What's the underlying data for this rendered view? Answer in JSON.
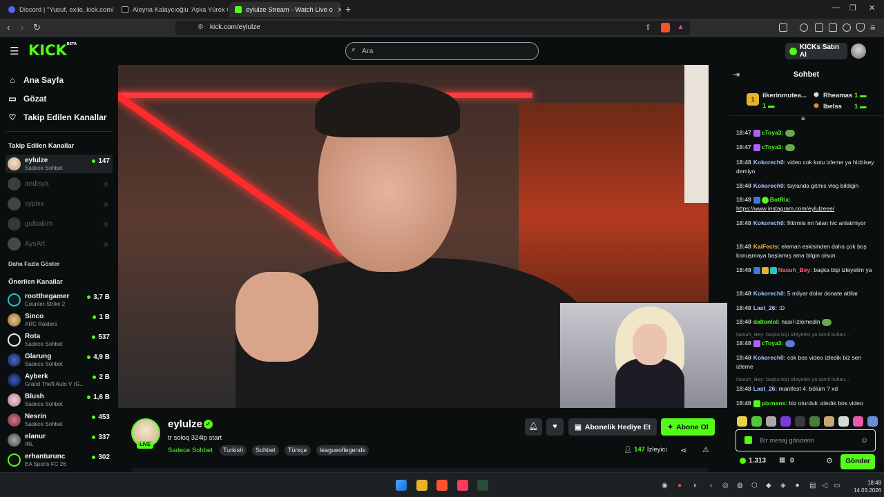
{
  "browser": {
    "tabs": [
      {
        "label": "Discord | \"Yusuf, exile, kick.com/",
        "color": "#5865f2"
      },
      {
        "label": "Aleyna Kalaycıoğlu 'Aşka Yürek Gerek",
        "color": "#111111"
      },
      {
        "label": "eylulze Stream - Watch Live o",
        "color": "#53fc18",
        "active": true
      }
    ],
    "new_tab": "+",
    "url": "kick.com/eylulze"
  },
  "header": {
    "logo": "KICK",
    "logo_sup": "BETA",
    "search_placeholder": "Ara",
    "buy_kicks": "KICKs Satın Al"
  },
  "sidebar": {
    "nav": [
      {
        "label": "Ana Sayfa",
        "icon": "home-icon"
      },
      {
        "label": "Gözat",
        "icon": "browse-icon"
      },
      {
        "label": "Takip Edilen Kanallar",
        "icon": "heart-icon"
      }
    ],
    "followed_title": "Takip Edilen Kanallar",
    "followed": [
      {
        "name": "eylulze",
        "sub": "Sadece Sohbet",
        "viewers": "147",
        "online": true
      },
      {
        "name": "andisya",
        "online": false
      },
      {
        "name": "sypixx",
        "online": false
      },
      {
        "name": "gulbakim",
        "online": false
      },
      {
        "name": "AysArt",
        "online": false
      }
    ],
    "show_more": "Daha Fazla Göster",
    "recommended_title": "Önerilen Kanallar",
    "recommended": [
      {
        "name": "rootthegamer",
        "sub": "Counter-Strike 2",
        "viewers": "3,7 B"
      },
      {
        "name": "Sinco",
        "sub": "ARC Raiders",
        "viewers": "1 B"
      },
      {
        "name": "Rota",
        "sub": "Sadece Sohbet",
        "viewers": "537"
      },
      {
        "name": "Glarung",
        "sub": "Sadece Sohbet",
        "viewers": "4,9 B"
      },
      {
        "name": "Ayberk",
        "sub": "Grand Theft Auto V (G...",
        "viewers": "2 B"
      },
      {
        "name": "Blush",
        "sub": "Sadece Sohbet",
        "viewers": "1,6 B"
      },
      {
        "name": "Nesrin",
        "sub": "Sadece Sohbet",
        "viewers": "453"
      },
      {
        "name": "elanur",
        "sub": "IRL",
        "viewers": "337"
      },
      {
        "name": "erhanturunc",
        "sub": "EA Sports FC 26",
        "viewers": "302"
      }
    ]
  },
  "stream": {
    "channel": "eylulze",
    "live": "LIVE",
    "title": "tr soloq 324lp start",
    "category": "Sadece Sohbet",
    "tags": [
      "Turkish",
      "Sohbet",
      "Türkçe",
      "leagueoflegends"
    ],
    "gift_sub": "Abonelik Hediye Et",
    "subscribe": "Abone Ol",
    "viewers": "147",
    "viewers_label": "İzleyici"
  },
  "chat": {
    "title": "Sohbet",
    "leaders": [
      {
        "rank": "1",
        "name": "ilkerinmutea...",
        "count": "1"
      },
      {
        "name": "Rheamas",
        "count": "1"
      },
      {
        "name": "lbelss",
        "count": "1"
      }
    ],
    "messages": [
      {
        "time": "18:47",
        "user": "cToya3:",
        "color": "#53fc18",
        "text": ""
      },
      {
        "time": "18:47",
        "user": "cToya3:",
        "color": "#53fc18",
        "text": ""
      },
      {
        "time": "18:48",
        "user": "Kokorech0:",
        "color": "#a5c8ff",
        "text": "video cok kotu izleme ya hicbisey demiyo"
      },
      {
        "time": "18:48",
        "user": "Kokorech0:",
        "color": "#a5c8ff",
        "text": "taylanda gitmis vlog bildigin"
      },
      {
        "time": "18:48",
        "user": "BotRix:",
        "color": "#53fc18",
        "text": "https://www.instagram.com/eylulzeee/"
      },
      {
        "time": "18:48",
        "user": "Kokorech0:",
        "color": "#a5c8ff",
        "text": "fittirmis mi falan hic anlatmiyor"
      },
      {
        "time": "18:48",
        "user": "KaiFects:",
        "color": "#ffb84d",
        "text": "eleman eskisinden daha çok boş konuşmaya başlamış ama bilgin olsun"
      },
      {
        "time": "18:48",
        "user": "Nasuh_Bey:",
        "color": "#ff5c7a",
        "text": "başka bişi izleyelim ya"
      },
      {
        "time": "18:48",
        "user": "Kokorech0:",
        "color": "#a5c8ff",
        "text": "5 milyar dolar donate attilar"
      },
      {
        "time": "18:48",
        "user": "Last_26:",
        "color": "#a5c8ff",
        "text": ":D"
      },
      {
        "time": "18:48",
        "user": "daltonlol:",
        "color": "#53fc18",
        "text": "nasıl izlemedin"
      },
      {
        "time": "18:48",
        "user": "cToya3:",
        "color": "#53fc18",
        "text": ""
      },
      {
        "time": "18:48",
        "user": "Kokorech0:",
        "color": "#a5c8ff",
        "text": "cok bos video izledik biz sen izleme"
      },
      {
        "time": "18:48",
        "user": "Last_26:",
        "color": "#a5c8ff",
        "text": "manifest 4. bölüm ? xd"
      },
      {
        "time": "18:48",
        "user": "pixmens:",
        "color": "#53fc18",
        "text": "biz oturduk ızledık bos video"
      }
    ],
    "reply1": "Nasuh_Bey: başka bişi izleyelim ya isimli kullan...",
    "reply2": "Nasuh_Bey: başka bişi izleyelim ya isimli kullan...",
    "input_placeholder": "Bir mesaj gönderin",
    "kicks_balance": "1.313",
    "gifts": "0",
    "send": "Gönder"
  },
  "taskbar": {
    "time": "18:48",
    "date": "14.03.2026"
  }
}
